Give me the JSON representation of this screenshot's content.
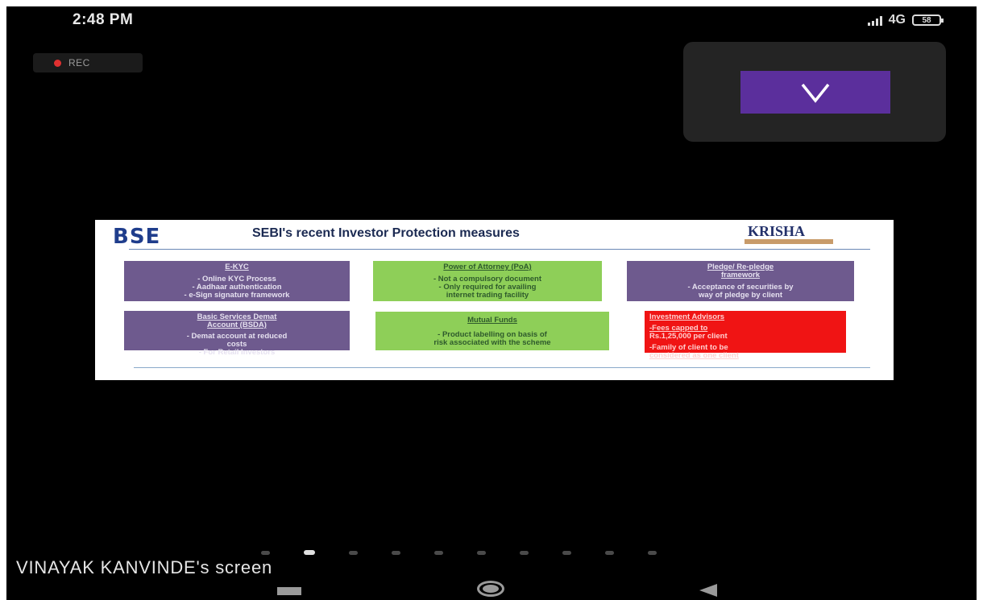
{
  "status_bar": {
    "time": "2:48 PM",
    "network": "4G",
    "battery": "58"
  },
  "recording": {
    "label": "REC"
  },
  "participant_tile": {
    "initial": "V"
  },
  "slide": {
    "logo_left": "BSE",
    "title": "SEBI's recent Investor Protection measures",
    "logo_right": "KRISHA",
    "boxes": [
      {
        "title": "E-KYC",
        "lines": [
          "- Online KYC Process",
          "- Aadhaar authentication",
          "- e-Sign signature framework"
        ]
      },
      {
        "title": "Power of Attorney (PoA)",
        "lines": [
          "- Not a compulsory document",
          "- Only required for availing",
          "internet trading facility"
        ]
      },
      {
        "title": "Pledge/ Re-pledge",
        "title2": "framework",
        "lines": [
          "- Acceptance of securities by",
          "way of pledge by client"
        ]
      },
      {
        "title": "Basic Services Demat",
        "title2": "Account (BSDA)",
        "lines": [
          "- Demat account at reduced",
          "costs",
          "- For Retail Investors"
        ]
      },
      {
        "title": "Mutual Funds",
        "lines": [
          "- Product labelling on basis of",
          "risk associated with the scheme"
        ]
      },
      {
        "title": "Investment Advisors",
        "lines": [
          "-Fees capped to",
          "Rs.1,25,000 per client",
          "-Family of client to be",
          "considered as one client"
        ]
      }
    ]
  },
  "pager": {
    "count": 10,
    "active_index": 1
  },
  "screen_owner": "VINAYAK KANVINDE's screen",
  "colors": {
    "purple": "#6e5a8e",
    "green": "#8ecf58",
    "red": "#f01414",
    "avatar": "#5b2f9c"
  }
}
